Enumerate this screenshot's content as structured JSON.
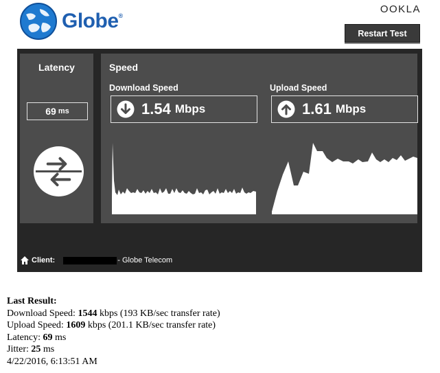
{
  "header": {
    "brand": "Globe",
    "brand_mark": "®",
    "ookla": "OOKLA",
    "restart_label": "Restart Test"
  },
  "latency": {
    "title": "Latency",
    "value": "69",
    "unit": "ms"
  },
  "speed": {
    "title": "Speed",
    "download": {
      "title": "Download Speed",
      "value": "1.54",
      "unit": "Mbps",
      "icon": "download-arrow-icon"
    },
    "upload": {
      "title": "Upload Speed",
      "value": "1.61",
      "unit": "Mbps",
      "icon": "upload-arrow-icon"
    }
  },
  "client": {
    "label": "Client:",
    "isp": "- Globe Telecom"
  },
  "results": {
    "heading": "Last Result:",
    "download_label": "Download Speed:",
    "download_value": "1544",
    "download_rest": "kbps (193 KB/sec transfer rate)",
    "upload_label": "Upload Speed:",
    "upload_value": "1609",
    "upload_rest": "kbps (201.1 KB/sec transfer rate)",
    "latency_label": "Latency:",
    "latency_value": "69",
    "latency_rest": "ms",
    "jitter_label": "Jitter:",
    "jitter_value": "25",
    "jitter_rest": "ms",
    "timestamp": "4/22/2016, 6:13:51 AM"
  },
  "colors": {
    "brand": "#1f5fb0",
    "panel": "#262626",
    "box": "#4c4c4c"
  }
}
